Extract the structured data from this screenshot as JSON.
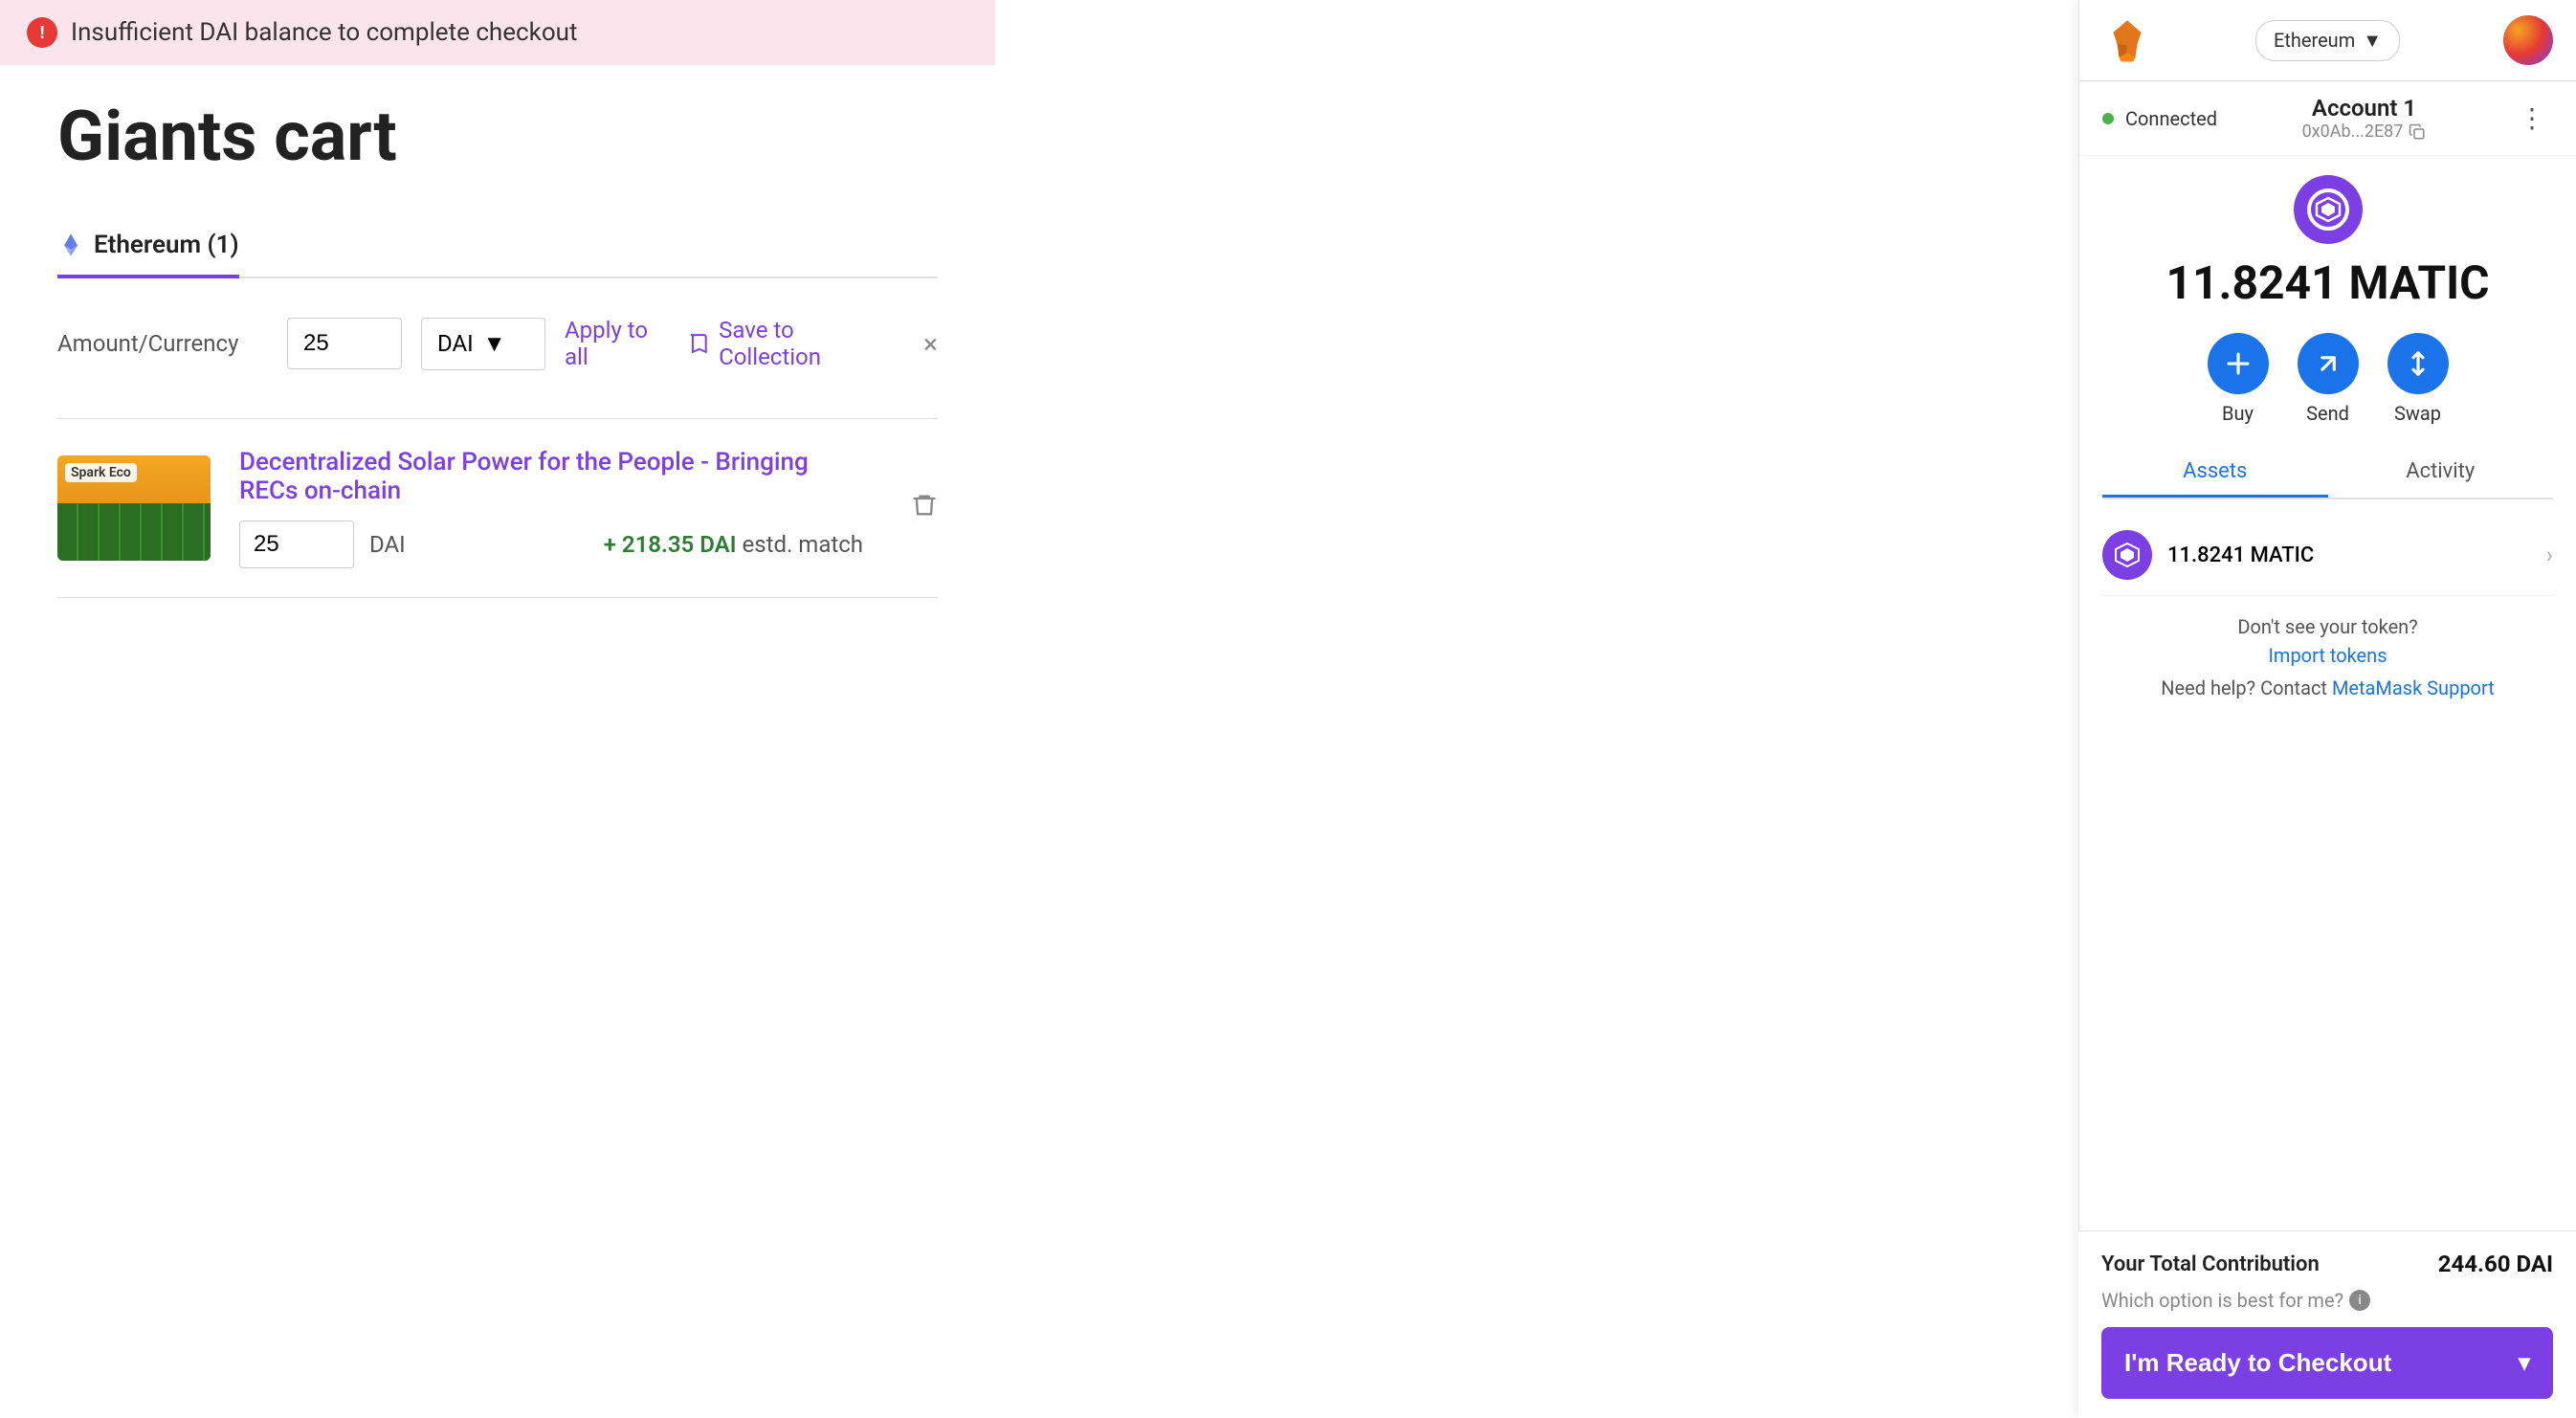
{
  "error": {
    "message": "Insufficient DAI balance to complete checkout"
  },
  "page": {
    "title": "Giants cart"
  },
  "tabs": [
    {
      "label": "Ethereum (1)",
      "active": true,
      "icon": "ethereum-icon"
    }
  ],
  "amount_currency": {
    "label": "Amount/Currency",
    "amount": "25",
    "currency": "DAI",
    "apply_to_all": "Apply to all",
    "save_to_collection": "Save to Collection",
    "close": "×"
  },
  "project": {
    "name": "Spark Eco",
    "title": "Decentralized Solar Power for the People - Bringing RECs on-chain",
    "amount": "25",
    "currency": "DAI",
    "estd_match_amount": "+ 218.35 DAI",
    "estd_match_label": "estd. match"
  },
  "metamask": {
    "network": "Ethereum",
    "account_name": "Account 1",
    "address": "0x0Ab...2E87",
    "connected_label": "Connected",
    "balance": "11.8241 MATIC",
    "balance_short": "11.8241",
    "balance_token": "MATIC",
    "actions": [
      {
        "label": "Buy",
        "icon": "buy-icon"
      },
      {
        "label": "Send",
        "icon": "send-icon"
      },
      {
        "label": "Swap",
        "icon": "swap-icon"
      }
    ],
    "tabs": [
      {
        "label": "Assets",
        "active": true
      },
      {
        "label": "Activity",
        "active": false
      }
    ],
    "assets": [
      {
        "name": "11.8241 MATIC",
        "value": ""
      }
    ],
    "import_tokens_text": "Don't see your token?",
    "import_tokens_link": "Import tokens",
    "help_text": "Need help? Contact",
    "help_link": "MetaMask Support"
  },
  "bottom": {
    "total_label": "Your Total Contribution",
    "total_value": "244.60 DAI",
    "which_option": "Which option is best for me?",
    "checkout_label": "I'm Ready to Checkout"
  }
}
